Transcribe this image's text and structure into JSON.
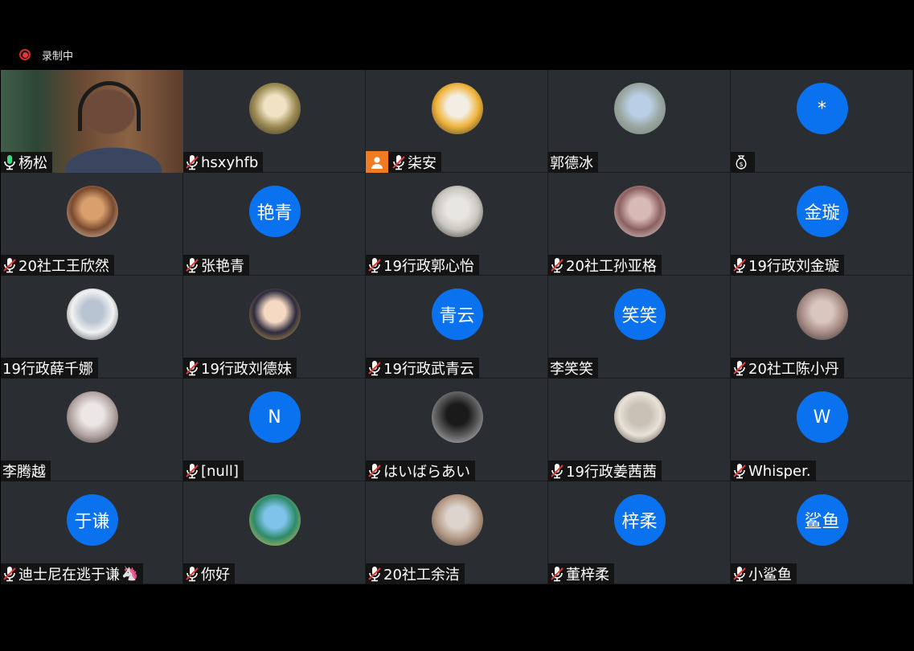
{
  "recording": {
    "label": "录制中"
  },
  "participants": [
    {
      "name": "杨松",
      "mic": "on",
      "kind": "video"
    },
    {
      "name": "hsxyhfb",
      "mic": "muted",
      "kind": "img",
      "colors": [
        "#f0e2c2",
        "#9b8a52",
        "#2f2a22"
      ]
    },
    {
      "name": "柒安",
      "mic": "muted",
      "kind": "img",
      "badge": "person",
      "colors": [
        "#f3eee4",
        "#f0b43a",
        "#2b2b2b"
      ]
    },
    {
      "name": "郭德冰",
      "mic": "none",
      "kind": "img",
      "colors": [
        "#b9cfe6",
        "#9aa6a0",
        "#6f7c73"
      ]
    },
    {
      "name": "",
      "mic": "none",
      "kind": "text",
      "avatar_text": "*",
      "badge": "moneybag"
    },
    {
      "name": "20社工王欣然",
      "mic": "muted",
      "kind": "img",
      "colors": [
        "#d9a06e",
        "#7a4a2f",
        "#e8d8c8"
      ]
    },
    {
      "name": "张艳青",
      "mic": "muted",
      "kind": "text",
      "avatar_text": "艳青"
    },
    {
      "name": "19行政郭心怡",
      "mic": "muted",
      "kind": "img",
      "colors": [
        "#e8e6e0",
        "#c9c6bf",
        "#2a2a2a"
      ]
    },
    {
      "name": "20社工孙亚格",
      "mic": "muted",
      "kind": "img",
      "colors": [
        "#d8b9b4",
        "#8a6060",
        "#f1e6e2"
      ]
    },
    {
      "name": "19行政刘金璇",
      "mic": "muted",
      "kind": "text",
      "avatar_text": "金璇"
    },
    {
      "name": "19行政薛千娜",
      "mic": "none",
      "kind": "img",
      "colors": [
        "#b9c4d2",
        "#f2f2f2",
        "#2b2f35"
      ]
    },
    {
      "name": "19行政刘德妹",
      "mic": "muted",
      "kind": "img",
      "colors": [
        "#f5d9c2",
        "#2c2b3f",
        "#e7b34a"
      ]
    },
    {
      "name": "19行政武青云",
      "mic": "muted",
      "kind": "text",
      "avatar_text": "青云"
    },
    {
      "name": "李笑笑",
      "mic": "none",
      "kind": "text",
      "avatar_text": "笑笑"
    },
    {
      "name": "20社工陈小丹",
      "mic": "muted",
      "kind": "img",
      "colors": [
        "#d8c6bf",
        "#a88d86",
        "#2d2a2a"
      ]
    },
    {
      "name": "李腾越",
      "mic": "none",
      "kind": "img",
      "colors": [
        "#ece7e6",
        "#b7aaa8",
        "#3b2f2f"
      ]
    },
    {
      "name": "[null]",
      "mic": "muted",
      "kind": "text",
      "avatar_text": "N"
    },
    {
      "name": "はいばらあい",
      "mic": "muted",
      "kind": "img",
      "colors": [
        "#1a1a1a",
        "#5a5a5a",
        "#d0d0d0"
      ]
    },
    {
      "name": "19行政姜茜茜",
      "mic": "muted",
      "kind": "img",
      "colors": [
        "#c9c1b5",
        "#e9e2d8",
        "#3a322c"
      ]
    },
    {
      "name": "Whisper.",
      "mic": "muted",
      "kind": "text",
      "avatar_text": "W"
    },
    {
      "name": "迪士尼在逃于谦",
      "mic": "muted",
      "kind": "text",
      "avatar_text": "于谦",
      "trail": "🦄"
    },
    {
      "name": "你好",
      "mic": "muted",
      "kind": "img",
      "colors": [
        "#7fc3ea",
        "#2e8a6a",
        "#f4c65a"
      ]
    },
    {
      "name": "20社工余洁",
      "mic": "muted",
      "kind": "img",
      "colors": [
        "#dcd4cc",
        "#b59b87",
        "#3a2f2a"
      ]
    },
    {
      "name": "董梓柔",
      "mic": "muted",
      "kind": "text",
      "avatar_text": "梓柔"
    },
    {
      "name": "小鲨鱼",
      "mic": "muted",
      "kind": "text",
      "avatar_text": "鲨鱼"
    }
  ]
}
